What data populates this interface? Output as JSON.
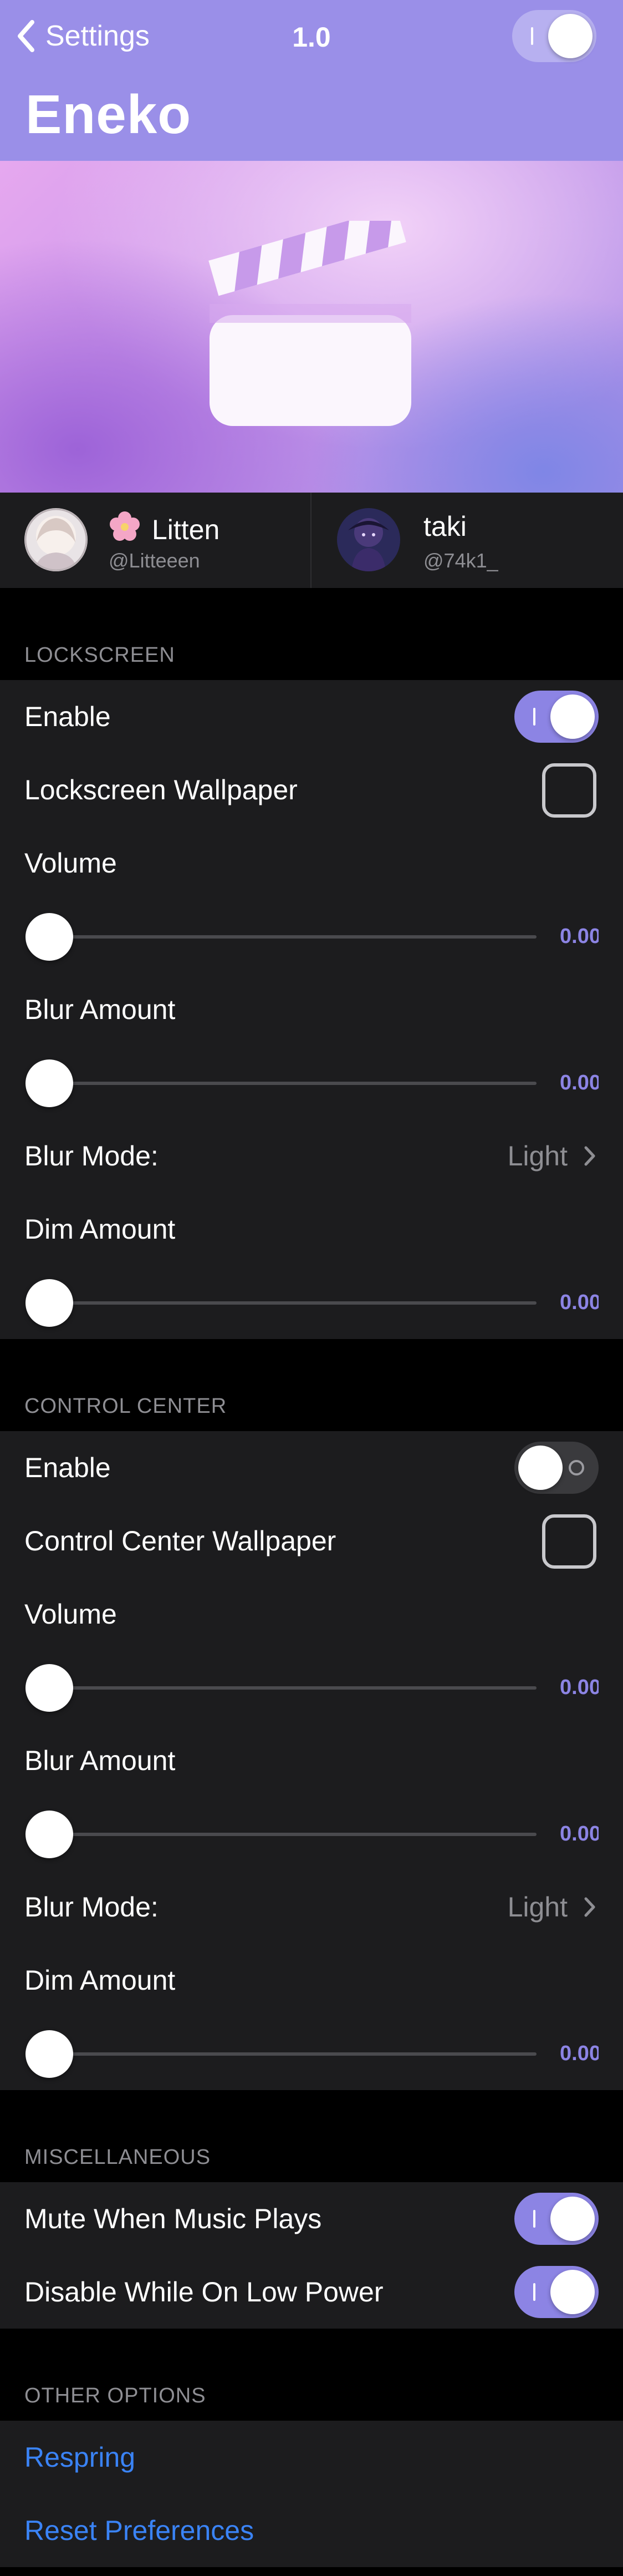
{
  "nav": {
    "back_label": "Settings",
    "version": "1.0",
    "master_toggle": true
  },
  "page_title": "Eneko",
  "colors": {
    "header": "#9a8fe8",
    "accent": "#8c84e4",
    "link": "#3a83f6",
    "cell": "#1c1c1e",
    "background": "#000000"
  },
  "credits": [
    {
      "name": "Litten",
      "handle": "@Litteeen",
      "emoji": "cherry-blossom-icon"
    },
    {
      "name": "taki",
      "handle": "@74k1_"
    }
  ],
  "lockscreen": {
    "header": "LOCKSCREEN",
    "enable_label": "Enable",
    "enable_on": true,
    "wallpaper_label": "Lockscreen Wallpaper",
    "wallpaper_checked": false,
    "volume_label": "Volume",
    "volume_value": "0.00",
    "blur_label": "Blur Amount",
    "blur_value": "0.00",
    "blur_mode_label": "Blur Mode:",
    "blur_mode_value": "Light",
    "dim_label": "Dim Amount",
    "dim_value": "0.00"
  },
  "control_center": {
    "header": "CONTROL CENTER",
    "enable_label": "Enable",
    "enable_on": false,
    "wallpaper_label": "Control Center Wallpaper",
    "wallpaper_checked": false,
    "volume_label": "Volume",
    "volume_value": "0.00",
    "blur_label": "Blur Amount",
    "blur_value": "0.00",
    "blur_mode_label": "Blur Mode:",
    "blur_mode_value": "Light",
    "dim_label": "Dim Amount",
    "dim_value": "0.00"
  },
  "misc": {
    "header": "MISCELLANEOUS",
    "mute_label": "Mute When Music Plays",
    "mute_on": true,
    "low_power_label": "Disable While On Low Power",
    "low_power_on": true
  },
  "other": {
    "header": "OTHER OPTIONS",
    "respring_label": "Respring",
    "reset_label": "Reset Preferences"
  }
}
